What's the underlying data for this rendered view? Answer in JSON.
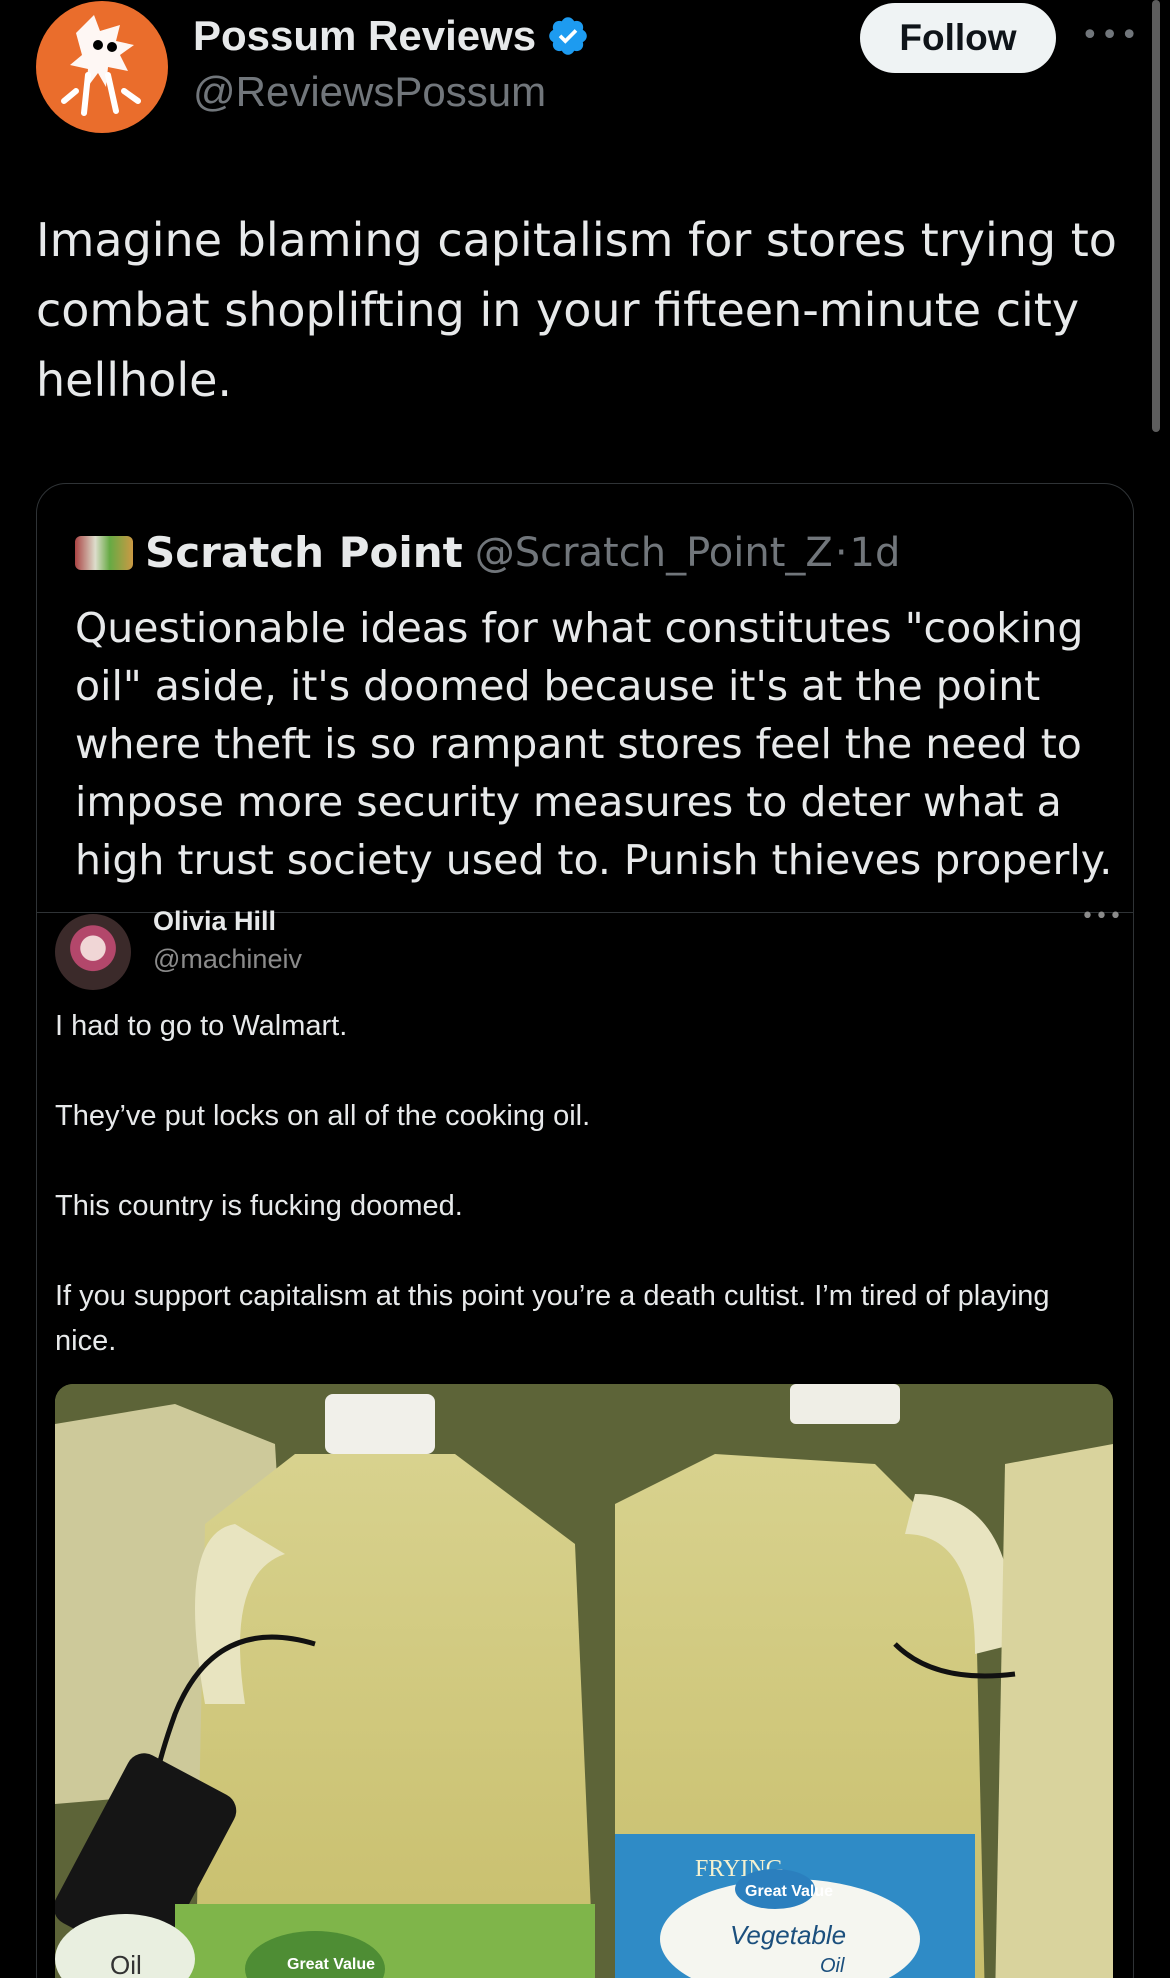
{
  "author": {
    "name": "Possum Reviews",
    "handle": "@ReviewsPossum",
    "verified": true,
    "follow_label": "Follow"
  },
  "tweet": {
    "text": "Imagine blaming capitalism for stores trying to combat shoplifting in your fifteen-minute city hellhole."
  },
  "quote": {
    "name": "Scratch Point",
    "handle": "@Scratch_Point_Z",
    "separator": "·",
    "time": "1d",
    "text": "Questionable ideas for what constitutes \"cooking oil\" aside, it's doomed because it's at the point where theft is so rampant stores feel the need to impose more security measures to deter what a high trust society used to. Punish thieves properly."
  },
  "embedded_post": {
    "name": "Olivia Hill",
    "handle": "@machineiv",
    "lines": [
      "I had to go to Walmart.",
      "They’ve put locks on all of the cooking oil.",
      "This country is fucking doomed.",
      "If you support capitalism at this point you’re a death cultist. I’m tired of playing nice."
    ]
  },
  "photo_labels": {
    "left_brand": "Great Value",
    "left_product": "Oil",
    "right_type": "FRYING",
    "right_brand": "Great Value",
    "right_product_1": "Vegetable",
    "right_product_2": "Oil"
  },
  "colors": {
    "background": "#000000",
    "text": "#e7e9ea",
    "muted": "#71767b",
    "verified_blue": "#1d9bf0",
    "avatar_orange": "#ea6d2c"
  }
}
